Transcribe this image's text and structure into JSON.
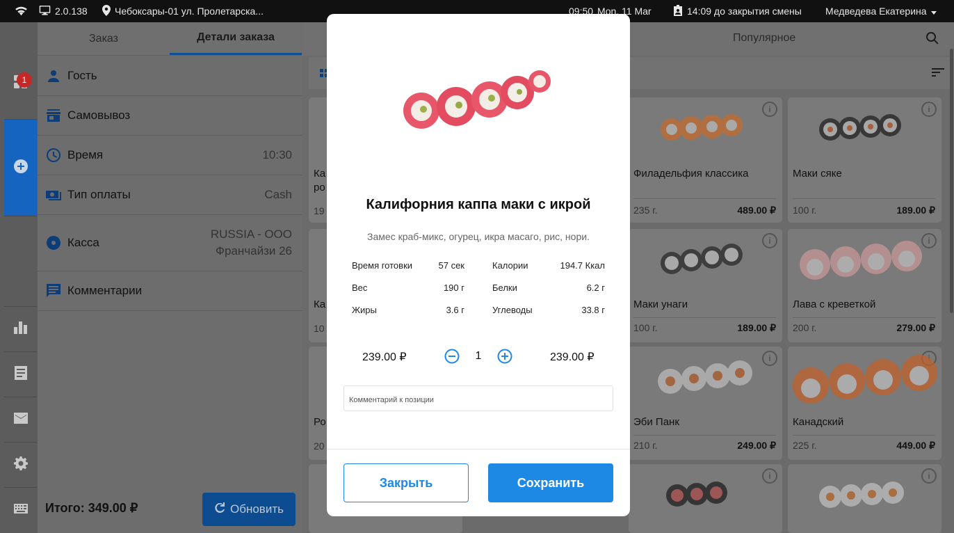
{
  "status_bar": {
    "version": "2.0.138",
    "location": "Чебоксары-01 ул. Пролетарска...",
    "time": "09:50",
    "date": "Mon, 11 Mar",
    "shift": "14:09 до закрытия смены",
    "user": "Медведева Екатерина"
  },
  "rail": {
    "badge": "1"
  },
  "order_panel": {
    "tabs": [
      "Заказ",
      "Детали заказа"
    ],
    "rows": {
      "guest": "Гость",
      "pickup": "Самовывоз",
      "time_label": "Время",
      "time_value": "10:30",
      "payment_label": "Тип оплаты",
      "payment_value": "Cash",
      "cashbox_label": "Касса",
      "cashbox_value_1": "RUSSIA - ООО",
      "cashbox_value_2": "Франчайзи 26",
      "comments": "Комментарии"
    },
    "total": "Итого: 349.00 ₽",
    "refresh": "Обновить"
  },
  "menu": {
    "category": "Популярное",
    "partial": {
      "r1": [
        "Ка",
        "ро",
        "19"
      ],
      "r2": [
        "Ка",
        "10"
      ],
      "r3": [
        "Ро",
        "20"
      ]
    },
    "items": [
      {
        "name": "Филадельфия классика",
        "weight": "235 г.",
        "price": "489.00 ₽"
      },
      {
        "name": "Маки сяке",
        "weight": "100 г.",
        "price": "189.00 ₽"
      },
      {
        "name": "Маки унаги",
        "weight": "100 г.",
        "price": "189.00 ₽"
      },
      {
        "name": "Лава с креветкой",
        "weight": "200 г.",
        "price": "279.00 ₽"
      },
      {
        "name": "Эби Панк",
        "weight": "210 г.",
        "price": "249.00 ₽"
      },
      {
        "name": "Канадский",
        "weight": "225 г.",
        "price": "449.00 ₽"
      }
    ]
  },
  "modal": {
    "title": "Калифорния каппа маки с икрой",
    "description": "Замес краб-микс, огурец, икра масаго, рис, нори.",
    "nutrition": {
      "cook_time_label": "Время готовки",
      "cook_time": "57 сек",
      "weight_label": "Вес",
      "weight": "190 г",
      "fat_label": "Жиры",
      "fat": "3.6 г",
      "calories_label": "Калории",
      "calories": "194.7 Ккал",
      "protein_label": "Белки",
      "protein": "6.2 г",
      "carbs_label": "Углеводы",
      "carbs": "33.8 г"
    },
    "unit_price": "239.00 ₽",
    "quantity": "1",
    "line_total": "239.00 ₽",
    "comment_placeholder": "Комментарий к позиции",
    "close_button": "Закрыть",
    "save_button": "Сохранить"
  },
  "colors": {
    "accent": "#1e88e5",
    "badge": "#c62828"
  }
}
